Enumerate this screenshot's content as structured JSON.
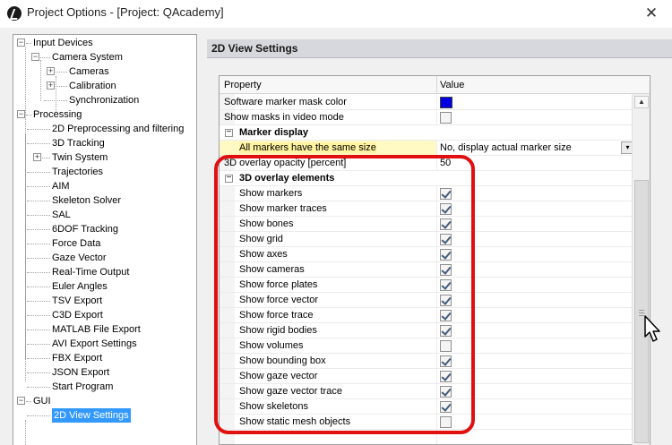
{
  "window": {
    "title": "Project Options - [Project: QAcademy]",
    "close_glyph": "✕",
    "icon": "qtm-logo-icon"
  },
  "tree": {
    "items": [
      {
        "label": "Input Devices",
        "expander": "−"
      },
      {
        "label": "Camera System",
        "expander": "−"
      },
      {
        "label": "Cameras",
        "expander": "+"
      },
      {
        "label": "Calibration",
        "expander": "+"
      },
      {
        "label": "Synchronization"
      },
      {
        "label": "Processing",
        "expander": "−"
      },
      {
        "label": "2D Preprocessing and filtering"
      },
      {
        "label": "3D Tracking"
      },
      {
        "label": "Twin System",
        "expander": "+"
      },
      {
        "label": "Trajectories"
      },
      {
        "label": "AIM"
      },
      {
        "label": "Skeleton Solver"
      },
      {
        "label": "SAL"
      },
      {
        "label": "6DOF Tracking"
      },
      {
        "label": "Force Data"
      },
      {
        "label": "Gaze Vector"
      },
      {
        "label": "Real-Time Output"
      },
      {
        "label": "Euler Angles"
      },
      {
        "label": "TSV Export"
      },
      {
        "label": "C3D Export"
      },
      {
        "label": "MATLAB File Export"
      },
      {
        "label": "AVI Export Settings"
      },
      {
        "label": "FBX Export"
      },
      {
        "label": "JSON Export"
      },
      {
        "label": "Start Program"
      },
      {
        "label": "GUI",
        "expander": "−"
      },
      {
        "label": "2D View Settings",
        "selected": true
      }
    ]
  },
  "panel": {
    "header": "2D View Settings",
    "columns": {
      "property": "Property",
      "value": "Value"
    },
    "rows": [
      {
        "name": "Software marker mask color",
        "kind": "color",
        "color": "#0000e0"
      },
      {
        "name": "Show masks in video mode",
        "kind": "check",
        "checked": false
      },
      {
        "name": "Marker display",
        "kind": "category",
        "expander": "−"
      },
      {
        "name": "All markers have the same size",
        "kind": "dropdown",
        "value": "No, display actual marker size",
        "highlight": true,
        "dropdown_glyph": "▾"
      },
      {
        "name": "3D overlay opacity [percent]",
        "kind": "text",
        "value": "50"
      },
      {
        "name": "3D overlay elements",
        "kind": "category",
        "expander": "−"
      },
      {
        "name": "Show markers",
        "kind": "check",
        "checked": true
      },
      {
        "name": "Show marker traces",
        "kind": "check",
        "checked": true
      },
      {
        "name": "Show bones",
        "kind": "check",
        "checked": true
      },
      {
        "name": "Show grid",
        "kind": "check",
        "checked": true
      },
      {
        "name": "Show axes",
        "kind": "check",
        "checked": true
      },
      {
        "name": "Show cameras",
        "kind": "check",
        "checked": true
      },
      {
        "name": "Show force plates",
        "kind": "check",
        "checked": true
      },
      {
        "name": "Show force vector",
        "kind": "check",
        "checked": true
      },
      {
        "name": "Show force trace",
        "kind": "check",
        "checked": true
      },
      {
        "name": "Show rigid bodies",
        "kind": "check",
        "checked": true
      },
      {
        "name": "Show volumes",
        "kind": "check",
        "checked": false
      },
      {
        "name": "Show bounding box",
        "kind": "check",
        "checked": true
      },
      {
        "name": "Show gaze vector",
        "kind": "check",
        "checked": true
      },
      {
        "name": "Show gaze vector trace",
        "kind": "check",
        "checked": true
      },
      {
        "name": "Show skeletons",
        "kind": "check",
        "checked": true
      },
      {
        "name": "Show static mesh objects",
        "kind": "check",
        "checked": false
      }
    ]
  },
  "scrollbar": {
    "up_glyph": "▲"
  },
  "colors": {
    "annotation": "#e01010",
    "selection": "#3399ff",
    "highlight": "#fff9c4"
  }
}
